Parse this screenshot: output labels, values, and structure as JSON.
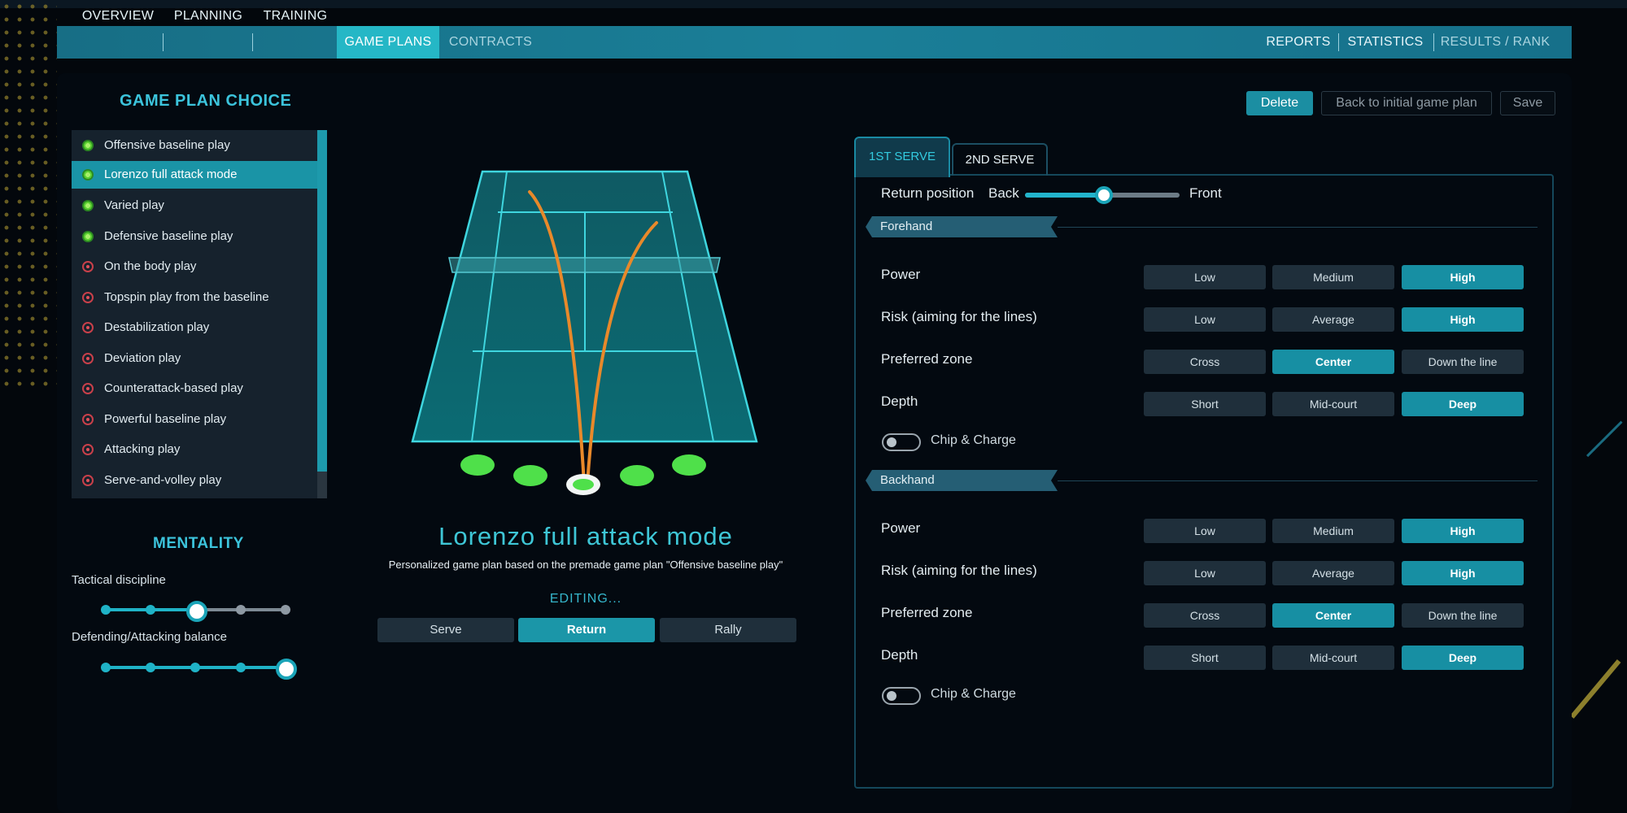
{
  "nav": {
    "left": [
      "OVERVIEW",
      "PLANNING",
      "TRAINING",
      "GAME PLANS",
      "CONTRACTS"
    ],
    "right": [
      "REPORTS",
      "STATISTICS",
      "RESULTS / RANK"
    ],
    "active": "GAME PLANS"
  },
  "actions": {
    "delete": "Delete",
    "back": "Back to initial game plan",
    "save": "Save"
  },
  "plan_choice": {
    "title": "GAME PLAN CHOICE",
    "items": [
      {
        "label": "Offensive baseline play",
        "status": "green"
      },
      {
        "label": "Lorenzo full attack mode",
        "status": "green"
      },
      {
        "label": "Varied play",
        "status": "green"
      },
      {
        "label": "Defensive baseline play",
        "status": "green"
      },
      {
        "label": "On the body play",
        "status": "red"
      },
      {
        "label": "Topspin play from the baseline",
        "status": "red"
      },
      {
        "label": "Destabilization play",
        "status": "red"
      },
      {
        "label": "Deviation play",
        "status": "red"
      },
      {
        "label": "Counterattack-based play",
        "status": "red"
      },
      {
        "label": "Powerful baseline play",
        "status": "red"
      },
      {
        "label": "Attacking play",
        "status": "red"
      },
      {
        "label": "Serve-and-volley play",
        "status": "red"
      }
    ],
    "selected_index": 1
  },
  "mentality": {
    "title": "MENTALITY",
    "tactical_label": "Tactical discipline",
    "tactical_level": 3,
    "balance_label": "Defending/Attacking balance",
    "balance_level": 5,
    "steps": 5
  },
  "plan": {
    "name": "Lorenzo full attack mode",
    "subtitle": "Personalized game plan based on the premade game plan \"Offensive baseline play\"",
    "editing": "EDITING...",
    "tabs": [
      "Serve",
      "Return",
      "Rally"
    ],
    "active_tab": "Return"
  },
  "serve_tabs": [
    "1ST SERVE",
    "2ND SERVE"
  ],
  "return_position": {
    "label": "Return position",
    "back": "Back",
    "front": "Front",
    "value": 0.52
  },
  "forehand": {
    "title": "Forehand",
    "rows": [
      {
        "label": "Power",
        "options": [
          "Low",
          "Medium",
          "High"
        ],
        "selected": 2
      },
      {
        "label": "Risk (aiming for the lines)",
        "options": [
          "Low",
          "Average",
          "High"
        ],
        "selected": 2
      },
      {
        "label": "Preferred zone",
        "options": [
          "Cross",
          "Center",
          "Down the line"
        ],
        "selected": 1
      },
      {
        "label": "Depth",
        "options": [
          "Short",
          "Mid-court",
          "Deep"
        ],
        "selected": 2
      }
    ],
    "chip": "Chip & Charge"
  },
  "backhand": {
    "title": "Backhand",
    "rows": [
      {
        "label": "Power",
        "options": [
          "Low",
          "Medium",
          "High"
        ],
        "selected": 2
      },
      {
        "label": "Risk (aiming for the lines)",
        "options": [
          "Low",
          "Average",
          "High"
        ],
        "selected": 2
      },
      {
        "label": "Preferred zone",
        "options": [
          "Cross",
          "Center",
          "Down the line"
        ],
        "selected": 1
      },
      {
        "label": "Depth",
        "options": [
          "Short",
          "Mid-court",
          "Deep"
        ],
        "selected": 2
      }
    ],
    "chip": "Chip & Charge"
  },
  "colors": {
    "accent": "#1b96a8",
    "title": "#3ec6d6",
    "trajectory": "#e8892a",
    "zone": "#4fe04a"
  }
}
